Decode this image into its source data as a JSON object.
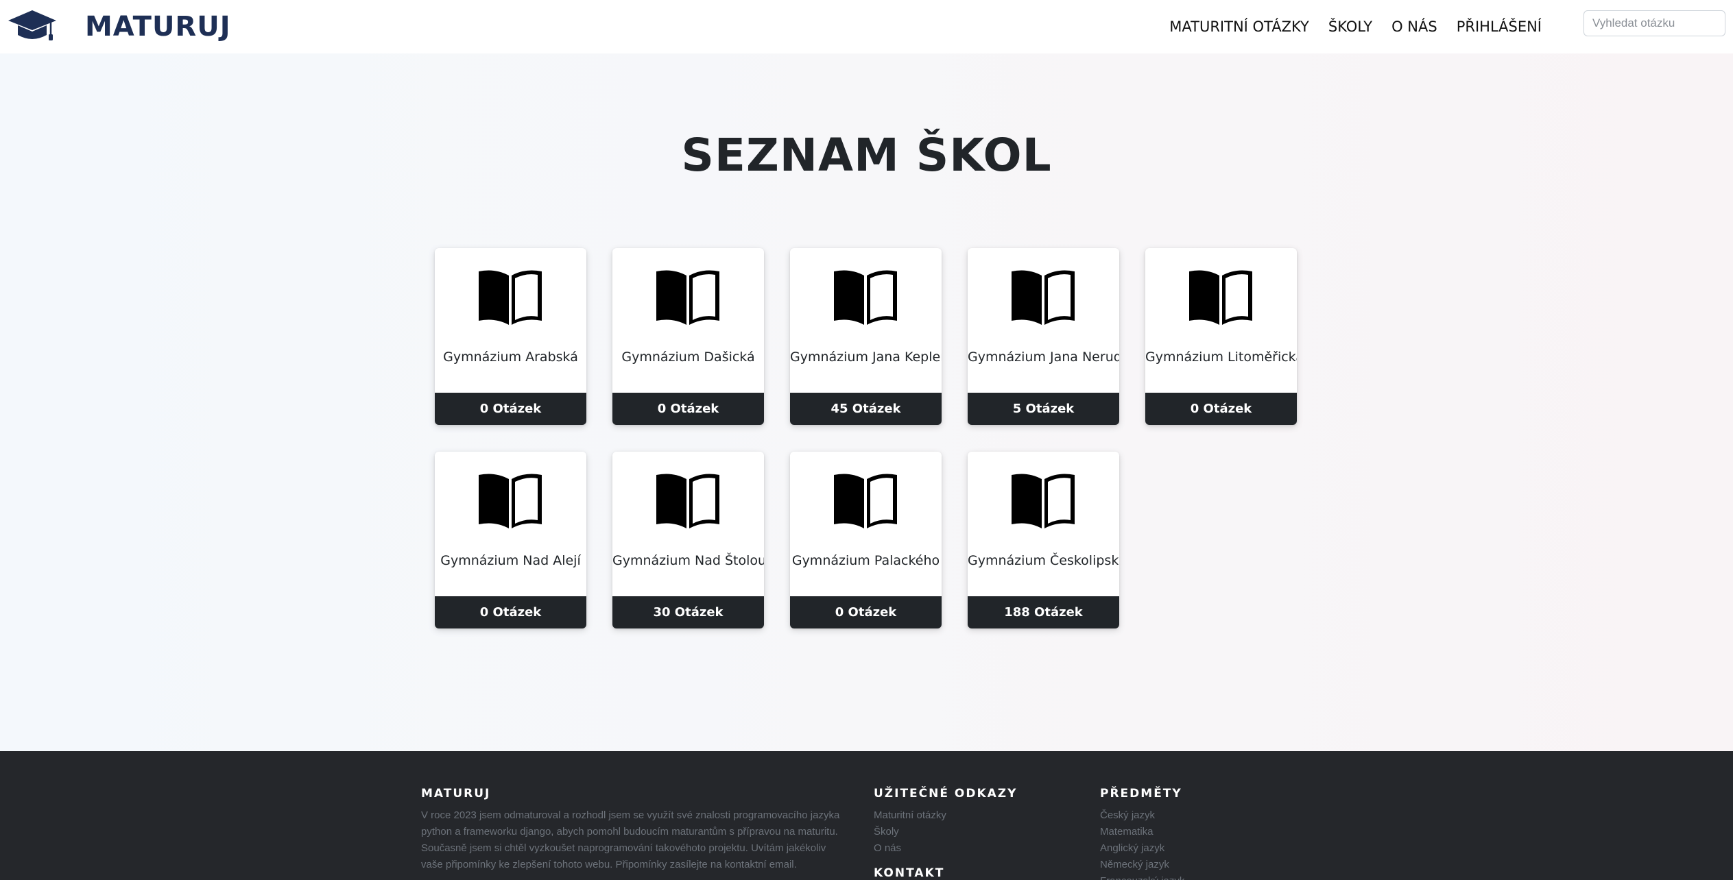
{
  "brand": {
    "name": "MATURUJ",
    "icon": "graduation-cap-icon",
    "color": "#1e2f55"
  },
  "nav": {
    "links": [
      "MATURITNÍ OTÁZKY",
      "ŠKOLY",
      "O NÁS",
      "PŘIHLÁŠENÍ"
    ],
    "search_placeholder": "Vyhledat otázku"
  },
  "page": {
    "title": "SEZNAM ŠKOL"
  },
  "schools": [
    {
      "name": "Gymnázium Arabská",
      "count": "0 Otázek"
    },
    {
      "name": "Gymnázium Dašická",
      "count": "0 Otázek"
    },
    {
      "name": "Gymnázium Jana Keplera",
      "count": "45 Otázek"
    },
    {
      "name": "Gymnázium Jana Nerudy",
      "count": "5 Otázek"
    },
    {
      "name": "Gymnázium Litoměřická",
      "count": "0 Otázek"
    },
    {
      "name": "Gymnázium Nad Alejí",
      "count": "0 Otázek"
    },
    {
      "name": "Gymnázium Nad Štolou",
      "count": "30 Otázek"
    },
    {
      "name": "Gymnázium Palackého",
      "count": "0 Otázek"
    },
    {
      "name": "Gymnázium Českolipská",
      "count": "188 Otázek"
    }
  ],
  "school_icon": "open-book-icon",
  "footer": {
    "about": {
      "title": "MATURUJ",
      "text": "V roce 2023 jsem odmaturoval a rozhodl jsem se využít své znalosti programovacího jazyka python a frameworku django, abych pomohl budoucím maturantům s přípravou na maturitu. Současně jsem si chtěl vyzkoušet naprogramování takovéhoto projektu. Uvítám jakékoliv vaše připomínky ke zlepšení tohoto webu. Připomínky zasílejte na kontaktní email."
    },
    "useful_links": {
      "title": "UŽITEČNÉ ODKAZY",
      "items": [
        "Maturitní otázky",
        "Školy",
        "O nás"
      ]
    },
    "contact": {
      "title": "KONTAKT"
    },
    "subjects": {
      "title": "PŘEDMĚTY",
      "items": [
        "Český jazyk",
        "Matematika",
        "Anglický jazyk",
        "Německý jazyk",
        "Francouzský jazyk"
      ]
    }
  },
  "colors": {
    "card_footer": "#212529",
    "footer_bg": "#25272b",
    "footer_text_muted": "#6c727a"
  }
}
